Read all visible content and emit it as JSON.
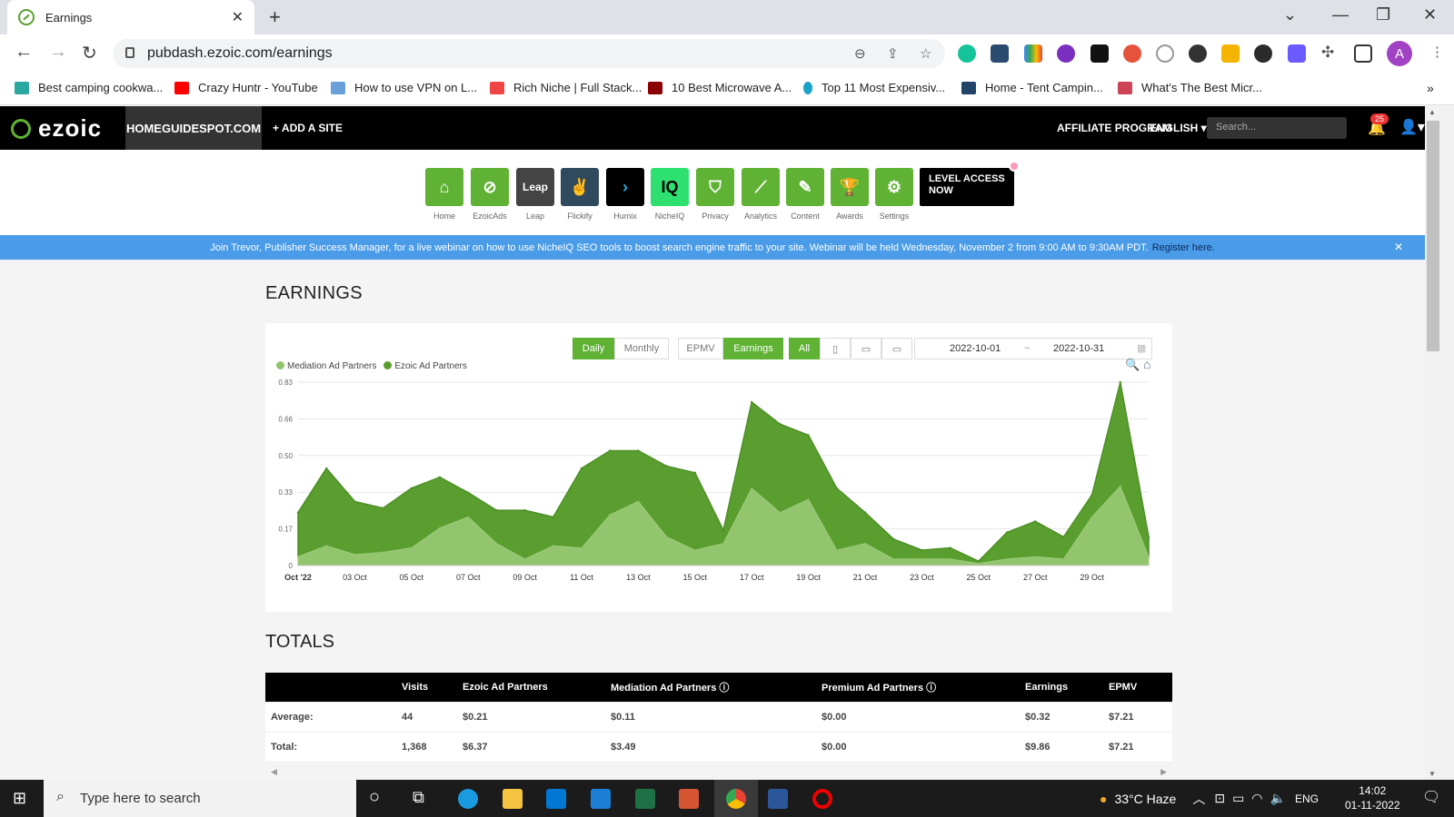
{
  "browser": {
    "tab_title": "Earnings",
    "tab_close": "✕",
    "new_tab": "+",
    "url": "pubdash.ezoic.com/earnings",
    "bookmarks": [
      "Best camping cookwa...",
      "Crazy Huntr - YouTube",
      "How to use VPN on L...",
      "Rich Niche | Full Stack...",
      "10 Best Microwave A...",
      "Top 11 Most Expensiv...",
      "Home - Tent Campin...",
      "What's The Best Micr..."
    ],
    "profile_initial": "A",
    "more": "»"
  },
  "ezoic": {
    "logo": "ezoic",
    "site": "HOMEGUIDESPOT.COM",
    "add_site": "+ ADD A SITE",
    "affiliate": "AFFILIATE PROGRAM",
    "language": "ENGLISH ▾",
    "search_placeholder": "Search...",
    "notif_count": "25",
    "apps": [
      "Home",
      "EzoicAds",
      "Leap",
      "Flickify",
      "Humix",
      "NicheIQ",
      "Privacy",
      "Analytics",
      "Content",
      "Awards",
      "Settings"
    ],
    "level_cta": "LEVEL ACCESS NOW"
  },
  "banner": {
    "text": "Join Trevor, Publisher Success Manager, for a live webinar on how to use NicheIQ SEO tools to boost search engine traffic to your site. Webinar will be held Wednesday, November 2 from 9:00 AM to 9:30AM PDT.",
    "link": "Register here.",
    "close": "✕"
  },
  "page": {
    "title": "EARNINGS",
    "totals_title": "TOTALS"
  },
  "controls": {
    "daily": "Daily",
    "monthly": "Monthly",
    "epmv": "EPMV",
    "earnings": "Earnings",
    "all": "All",
    "date_from": "2022-10-01",
    "date_sep": "~",
    "date_to": "2022-10-31"
  },
  "chart_data": {
    "type": "area",
    "x": [
      "Oct '22",
      "03 Oct",
      "05 Oct",
      "07 Oct",
      "09 Oct",
      "11 Oct",
      "13 Oct",
      "15 Oct",
      "17 Oct",
      "19 Oct",
      "21 Oct",
      "23 Oct",
      "25 Oct",
      "27 Oct",
      "29 Oct"
    ],
    "y_ticks": [
      "0",
      "0.17",
      "0.33",
      "0.50",
      "0.66",
      "0.83"
    ],
    "ylim": [
      0,
      0.83
    ],
    "legend_position": "top-left",
    "grid": true,
    "series": [
      {
        "name": "Mediation Ad Partners",
        "color": "#93c46e",
        "values": [
          0.04,
          0.09,
          0.05,
          0.06,
          0.08,
          0.17,
          0.22,
          0.1,
          0.03,
          0.09,
          0.08,
          0.23,
          0.29,
          0.13,
          0.07,
          0.1,
          0.35,
          0.24,
          0.3,
          0.07,
          0.1,
          0.03,
          0.03,
          0.03,
          0.01,
          0.03,
          0.04,
          0.03,
          0.22,
          0.36,
          0.04
        ]
      },
      {
        "name": "Ezoic Ad Partners",
        "color": "#5a9e2f",
        "values": [
          0.2,
          0.35,
          0.24,
          0.2,
          0.27,
          0.23,
          0.11,
          0.15,
          0.22,
          0.13,
          0.36,
          0.29,
          0.23,
          0.32,
          0.35,
          0.06,
          0.39,
          0.4,
          0.29,
          0.28,
          0.14,
          0.09,
          0.04,
          0.05,
          0.01,
          0.12,
          0.16,
          0.1,
          0.1,
          0.47,
          0.09
        ]
      }
    ]
  },
  "totals": {
    "headers": [
      "",
      "Visits",
      "Ezoic Ad Partners",
      "Mediation Ad Partners ⓘ",
      "Premium Ad Partners ⓘ",
      "Earnings",
      "EPMV"
    ],
    "rows": [
      [
        "Average:",
        "44",
        "$0.21",
        "$0.11",
        "$0.00",
        "$0.32",
        "$7.21"
      ],
      [
        "Total:",
        "1,368",
        "$6.37",
        "$3.49",
        "$0.00",
        "$9.86",
        "$7.21"
      ]
    ]
  },
  "taskbar": {
    "search_placeholder": "Type here to search",
    "weather": "33°C  Haze",
    "lang": "ENG",
    "time": "14:02",
    "date": "01-11-2022"
  }
}
